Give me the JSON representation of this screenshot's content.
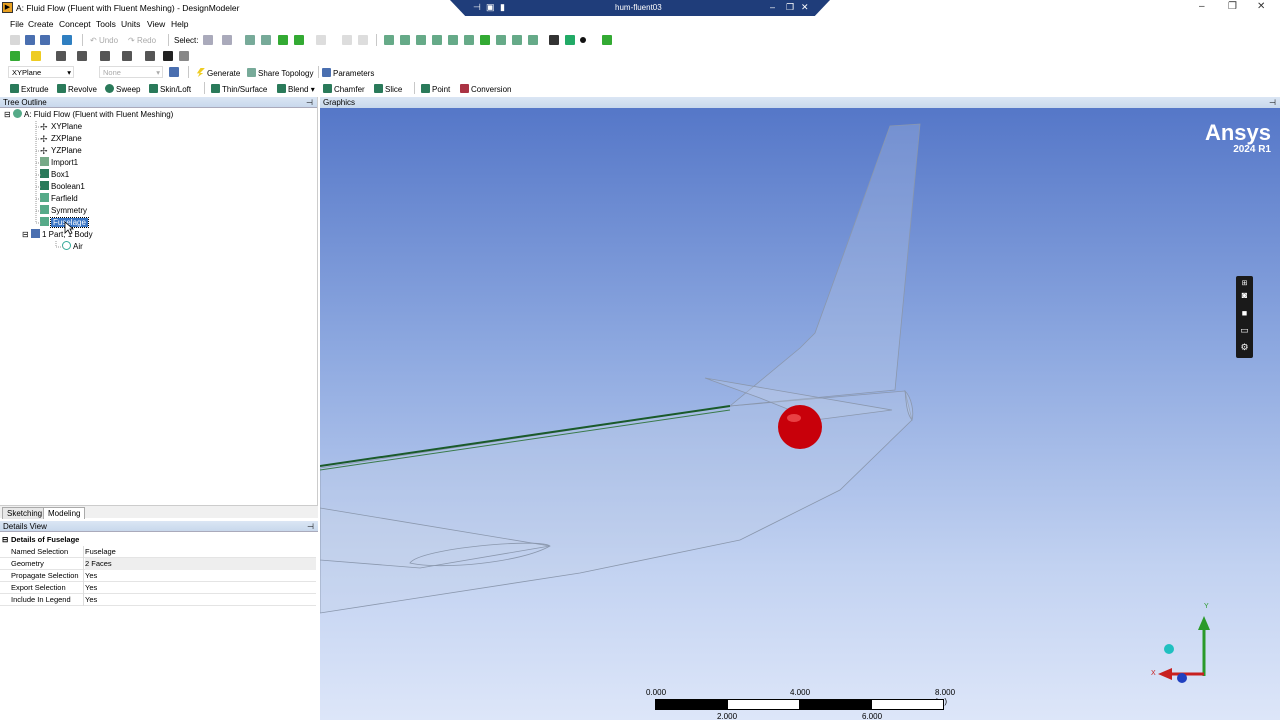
{
  "window": {
    "title": "A: Fluid Flow (Fluent with Fluent Meshing) - DesignModeler",
    "app_icon": "designmodeler-icon",
    "remote_session_title": "hum-fluent03"
  },
  "menu": [
    "File",
    "Create",
    "Concept",
    "Tools",
    "Units",
    "View",
    "Help"
  ],
  "toolbar1": {
    "undo_label": "Undo",
    "redo_label": "Redo",
    "select_label": "Select:"
  },
  "toolbar3": {
    "plane_value": "XYPlane",
    "sketch_value": "None",
    "generate_label": "Generate",
    "share_topology_label": "Share Topology",
    "parameters_label": "Parameters"
  },
  "toolbar4": {
    "extrude": "Extrude",
    "revolve": "Revolve",
    "sweep": "Sweep",
    "skin_loft": "Skin/Loft",
    "thin_surface": "Thin/Surface",
    "blend": "Blend",
    "chamfer": "Chamfer",
    "slice": "Slice",
    "point": "Point",
    "conversion": "Conversion"
  },
  "tree": {
    "header": "Tree Outline",
    "root": "A: Fluid Flow (Fluent with Fluent Meshing)",
    "items": [
      {
        "label": "XYPlane",
        "icon": "plane-icon"
      },
      {
        "label": "ZXPlane",
        "icon": "plane-icon"
      },
      {
        "label": "YZPlane",
        "icon": "plane-icon"
      },
      {
        "label": "Import1",
        "icon": "import-icon"
      },
      {
        "label": "Box1",
        "icon": "box-icon"
      },
      {
        "label": "Boolean1",
        "icon": "boolean-icon"
      },
      {
        "label": "Farfield",
        "icon": "named-selection-icon"
      },
      {
        "label": "Symmetry",
        "icon": "named-selection-icon"
      },
      {
        "label": "Fuselage",
        "icon": "named-selection-icon"
      }
    ],
    "parts": "1 Part, 1 Body",
    "body": "Air"
  },
  "tabs": {
    "sketching": "Sketching",
    "modeling": "Modeling"
  },
  "details": {
    "header": "Details View",
    "title": "Details of Fuselage",
    "rows": [
      {
        "key": "Named Selection",
        "value": "Fuselage"
      },
      {
        "key": "Geometry",
        "value": "2 Faces"
      },
      {
        "key": "Propagate Selection",
        "value": "Yes"
      },
      {
        "key": "Export Selection",
        "value": "Yes"
      },
      {
        "key": "Include In Legend",
        "value": "Yes"
      }
    ]
  },
  "graphics": {
    "header": "Graphics",
    "brand": "Ansys",
    "version": "2024 R1",
    "scale": {
      "start": "0.000",
      "mid": "4.000",
      "end": "8.000 (m)",
      "sub1": "2.000",
      "sub2": "6.000"
    },
    "triad_y": "Y",
    "triad_x": "X"
  },
  "colors": {
    "viewport_top": "#5577c8",
    "viewport_bottom": "#dde6f9",
    "selection": "#3a75c4",
    "point_marker": "#cc0000"
  }
}
